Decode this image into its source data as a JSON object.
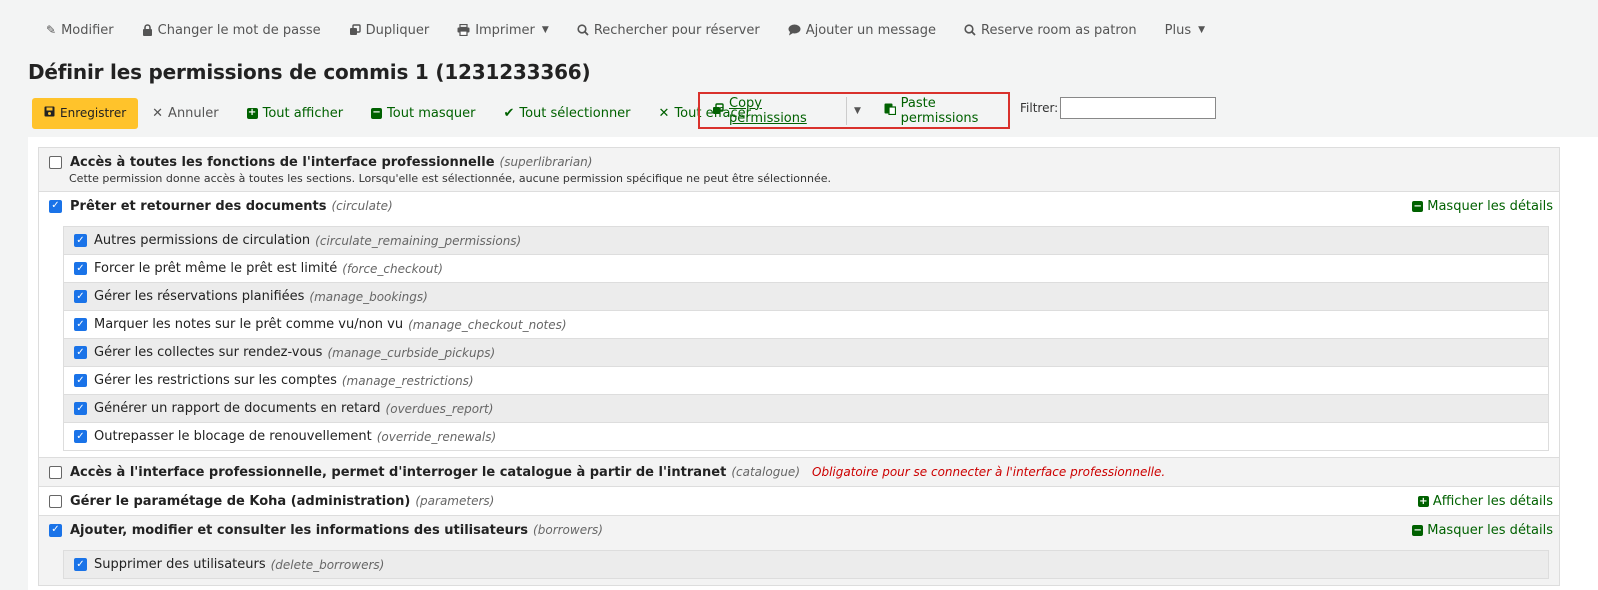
{
  "top_toolbar": {
    "items": [
      {
        "label": "Modifier",
        "icon": "pencil-icon"
      },
      {
        "label": "Changer le mot de passe",
        "icon": "lock-icon"
      },
      {
        "label": "Dupliquer",
        "icon": "copy-icon"
      },
      {
        "label": "Imprimer",
        "icon": "print-icon"
      },
      {
        "label": "Rechercher pour réserver",
        "icon": "search-icon"
      },
      {
        "label": "Ajouter un message",
        "icon": "comment-icon"
      },
      {
        "label": "Reserve room as patron",
        "icon": "search-icon"
      },
      {
        "label": "Plus",
        "icon": "caret-down-icon"
      }
    ]
  },
  "page_title": "Définir les permissions de commis 1 (1231233366)",
  "action_bar": {
    "save": "Enregistrer",
    "cancel": "Annuler",
    "show_all": "Tout afficher",
    "hide_all": "Tout masquer",
    "select_all": "Tout sélectionner",
    "clear_all": "Tout effacer",
    "copy": " Copy permissions",
    "paste": "Paste permissions",
    "filter_label": "Filtrer:",
    "filter_value": ""
  },
  "permissions": {
    "superlibrarian": {
      "title": "Accès à toutes les fonctions de l'interface professionnelle",
      "code": "(superlibrarian)",
      "checked": false,
      "description": "Cette permission donne accès à toutes les sections. Lorsqu'elle est sélectionnée, aucune permission spécifique ne peut être sélectionnée."
    },
    "circulate": {
      "title": "Prêter et retourner des documents",
      "code": "(circulate)",
      "checked": true,
      "toggle": "Masquer les détails",
      "subs": [
        {
          "label": "Autres permissions de circulation",
          "code": "(circulate_remaining_permissions)",
          "checked": true
        },
        {
          "label": "Forcer le prêt même le prêt est limité",
          "code": "(force_checkout)",
          "checked": true
        },
        {
          "label": "Gérer les réservations planifiées",
          "code": "(manage_bookings)",
          "checked": true
        },
        {
          "label": "Marquer les notes sur le prêt comme vu/non vu",
          "code": "(manage_checkout_notes)",
          "checked": true
        },
        {
          "label": "Gérer les collectes sur rendez-vous",
          "code": "(manage_curbside_pickups)",
          "checked": true
        },
        {
          "label": "Gérer les restrictions sur les comptes",
          "code": "(manage_restrictions)",
          "checked": true
        },
        {
          "label": "Générer un rapport de documents en retard",
          "code": "(overdues_report)",
          "checked": true
        },
        {
          "label": "Outrepasser le blocage de renouvellement",
          "code": "(override_renewals)",
          "checked": true
        }
      ]
    },
    "catalogue": {
      "title": "Accès à l'interface professionnelle, permet d'interroger le catalogue à partir de l'intranet",
      "code": "(catalogue)",
      "checked": false,
      "warning": "Obligatoire pour se connecter à l'interface professionnelle."
    },
    "parameters": {
      "title": "Gérer le paramétage de Koha (administration)",
      "code": "(parameters)",
      "checked": false,
      "toggle": "Afficher les détails"
    },
    "borrowers": {
      "title": "Ajouter, modifier et consulter les informations des utilisateurs",
      "code": "(borrowers)",
      "checked": true,
      "toggle": "Masquer les détails",
      "subs": [
        {
          "label": "Supprimer des utilisateurs",
          "code": "(delete_borrowers)",
          "checked": true
        }
      ]
    }
  },
  "colors": {
    "save_bg": "#ffc32b",
    "link_green": "#006100",
    "highlight_red": "#d9312c",
    "checkbox_blue": "#1a73e8"
  }
}
